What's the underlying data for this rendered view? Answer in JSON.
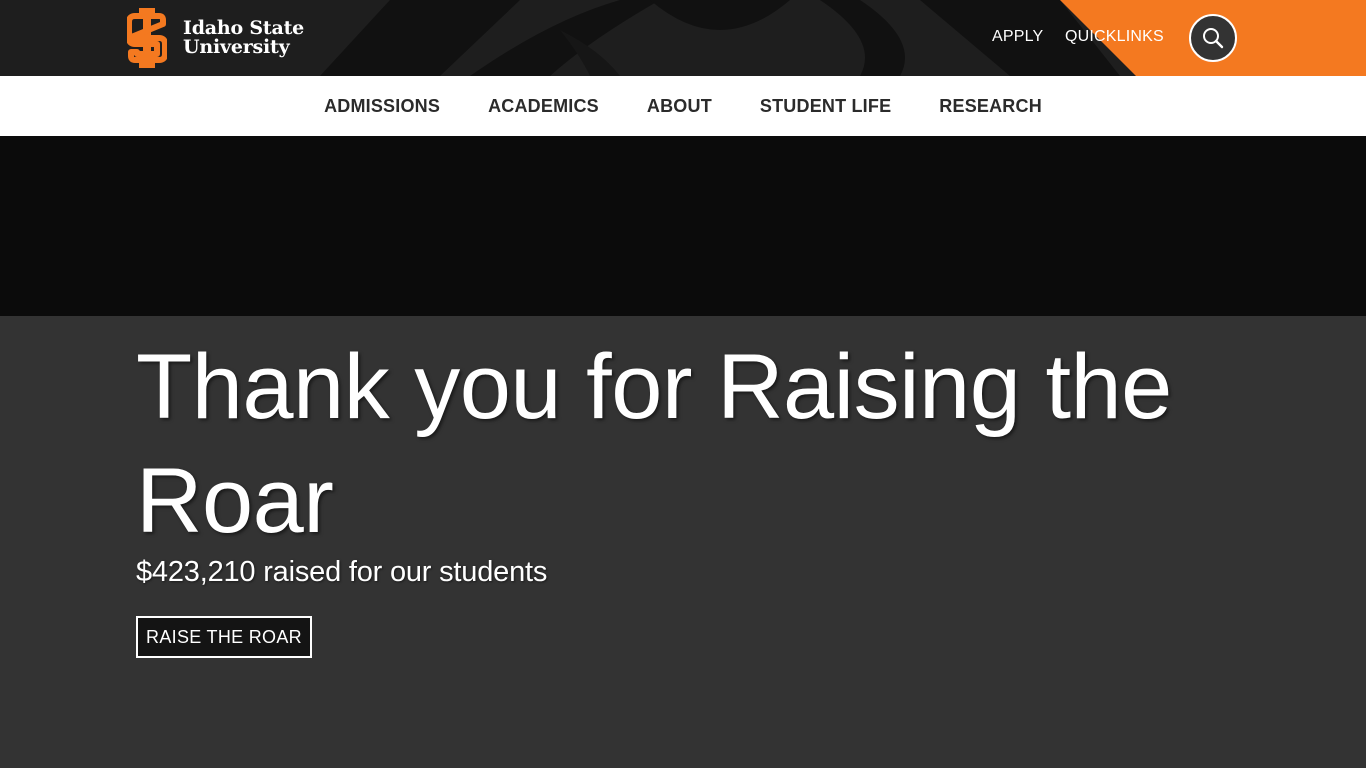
{
  "header": {
    "logo": {
      "line1": "Idaho State",
      "line2": "University",
      "icon": "isu-logo-icon"
    },
    "utility_links": {
      "apply": "APPLY",
      "quicklinks": "QUICKLINKS"
    },
    "search": {
      "icon": "search-icon"
    }
  },
  "nav": {
    "items": [
      {
        "label": "ADMISSIONS"
      },
      {
        "label": "ACADEMICS"
      },
      {
        "label": "ABOUT"
      },
      {
        "label": "STUDENT LIFE"
      },
      {
        "label": "RESEARCH"
      }
    ]
  },
  "hero": {
    "title": "Thank you for Raising the Roar",
    "subtitle": "$423,210 raised for our students",
    "button": "RAISE THE ROAR"
  },
  "colors": {
    "brand_orange": "#f47920",
    "header_dark": "#1e1e1e",
    "hero_band": "#0b0b0b",
    "hero_bg": "#333333",
    "white": "#ffffff"
  }
}
